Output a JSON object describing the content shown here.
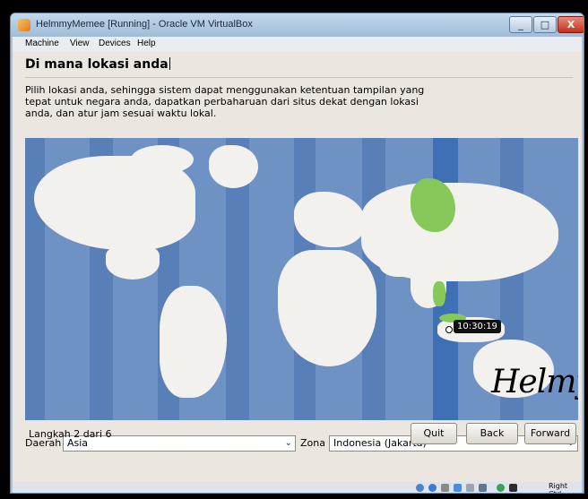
{
  "window": {
    "title": "HelmmyMemee [Running] - Oracle VM VirtualBox",
    "minimize_label": "_",
    "maximize_label": "□",
    "close_label": "X"
  },
  "menu": {
    "items": [
      "Machine",
      "View",
      "Devices",
      "Help"
    ]
  },
  "installer": {
    "heading": "Di mana lokasi anda",
    "description": "Pilih lokasi anda, sehingga sistem dapat menggunakan ketentuan tampilan yang tepat untuk negara anda, dapatkan perbaharuan dari situs dekat dengan lokasi anda, dan atur jam sesuai waktu lokal.",
    "map": {
      "time": "10:30:19",
      "signature": "Helmy"
    },
    "region_label": "Daerah",
    "region_value": "Asia",
    "zone_label": "Zona",
    "zone_value": "Indonesia (Jakarta)",
    "step_text": "Langkah 2 dari 6",
    "buttons": {
      "quit": "Quit",
      "back": "Back",
      "forward": "Forward"
    }
  },
  "statusbar": {
    "host_key": "Right Ctrl"
  }
}
